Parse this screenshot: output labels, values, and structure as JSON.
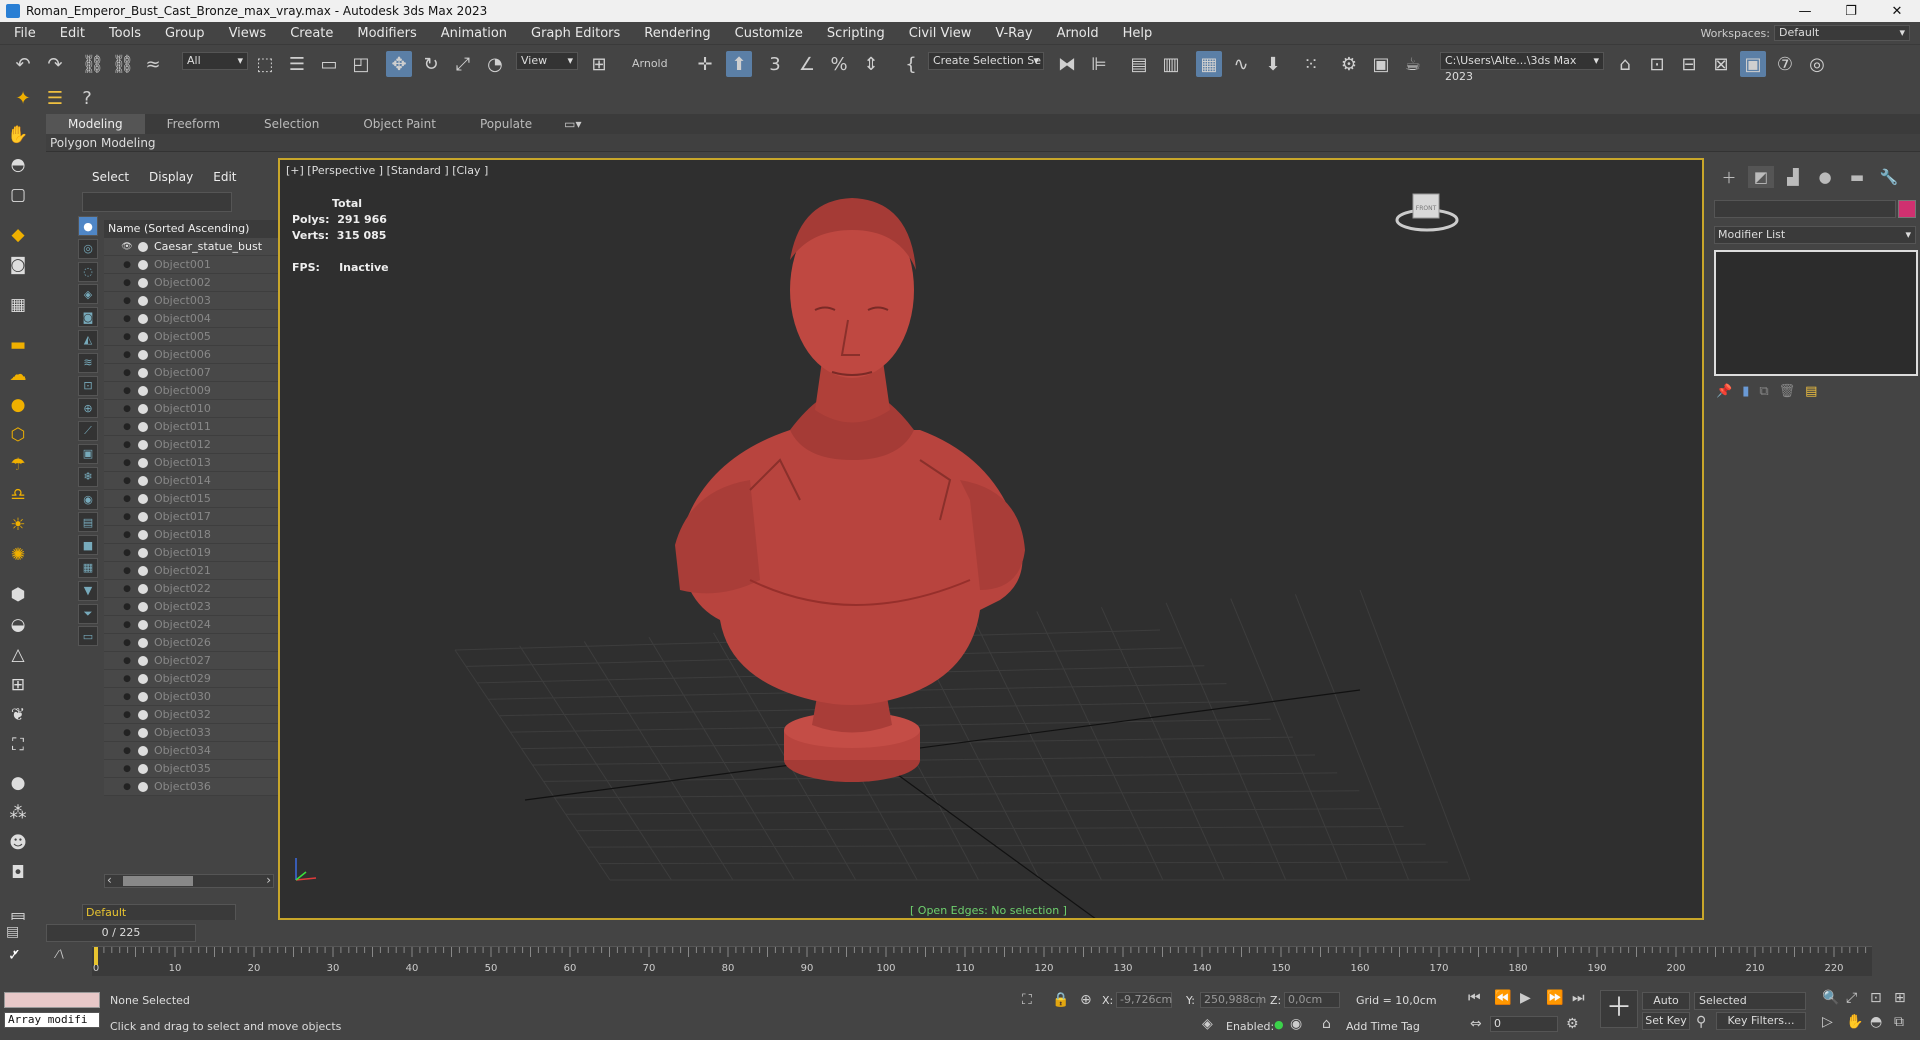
{
  "window": {
    "title": "Roman_Emperor_Bust_Cast_Bronze_max_vray.max - Autodesk 3ds Max 2023",
    "minimize": "—",
    "restore": "❐",
    "close": "✕"
  },
  "menu": [
    "File",
    "Edit",
    "Tools",
    "Group",
    "Views",
    "Create",
    "Modifiers",
    "Animation",
    "Graph Editors",
    "Rendering",
    "Customize",
    "Scripting",
    "Civil View",
    "V-Ray",
    "Arnold",
    "Help"
  ],
  "workspace": {
    "label": "Workspaces:",
    "value": "Default"
  },
  "toolbar": {
    "selection_filter": "All",
    "ref_coord": "View",
    "arnold_label": "Arnold",
    "named_selection": "Create Selection Se",
    "project_path": "C:\\Users\\Alte...\\3ds Max 2023"
  },
  "ribbon": {
    "tabs": [
      "Modeling",
      "Freeform",
      "Selection",
      "Object Paint",
      "Populate"
    ],
    "active": "Modeling",
    "sub_label": "Polygon Modeling"
  },
  "explorer": {
    "tabs": [
      "Select",
      "Display",
      "Edit"
    ],
    "header": "Name (Sorted Ascending)",
    "root": "Caesar_statue_bust",
    "objects": [
      "Object001",
      "Object002",
      "Object003",
      "Object004",
      "Object005",
      "Object006",
      "Object007",
      "Object009",
      "Object010",
      "Object011",
      "Object012",
      "Object013",
      "Object014",
      "Object015",
      "Object017",
      "Object018",
      "Object019",
      "Object021",
      "Object022",
      "Object023",
      "Object024",
      "Object026",
      "Object027",
      "Object029",
      "Object030",
      "Object032",
      "Object033",
      "Object034",
      "Object035",
      "Object036"
    ],
    "layer": "Default"
  },
  "viewport": {
    "label": "[+] [Perspective ] [Standard ] [Clay ]",
    "stats_total": "Total",
    "polys_label": "Polys:",
    "polys_value": "291 966",
    "verts_label": "Verts:",
    "verts_value": "315 085",
    "fps_label": "FPS:",
    "fps_value": "Inactive",
    "status": "[ Open Edges: No selection ]",
    "viewcube_label": "FRONT",
    "bust_color": "#b8443e"
  },
  "command_panel": {
    "modifier_list": "Modifier List",
    "object_color": "#d03070"
  },
  "timeline": {
    "slider": "0 / 225",
    "ticks": [
      "0",
      "10",
      "20",
      "30",
      "40",
      "50",
      "60",
      "70",
      "80",
      "90",
      "100",
      "110",
      "120",
      "130",
      "140",
      "150",
      "160",
      "170",
      "180",
      "190",
      "200",
      "210",
      "220"
    ]
  },
  "status": {
    "maxscript": "Array modifi",
    "selection": "None Selected",
    "prompt": "Click and drag to select and move objects",
    "x_label": "X:",
    "x_value": "-9,726cm",
    "y_label": "Y:",
    "y_value": "250,988cm",
    "z_label": "Z:",
    "z_value": "0,0cm",
    "grid": "Grid = 10,0cm",
    "enabled_label": "Enabled:",
    "add_time_tag": "Add Time Tag",
    "auto_key": "Auto Key",
    "set_key": "Set Key",
    "key_mode": "Selected",
    "key_filters": "Key Filters...",
    "frame": "0"
  }
}
